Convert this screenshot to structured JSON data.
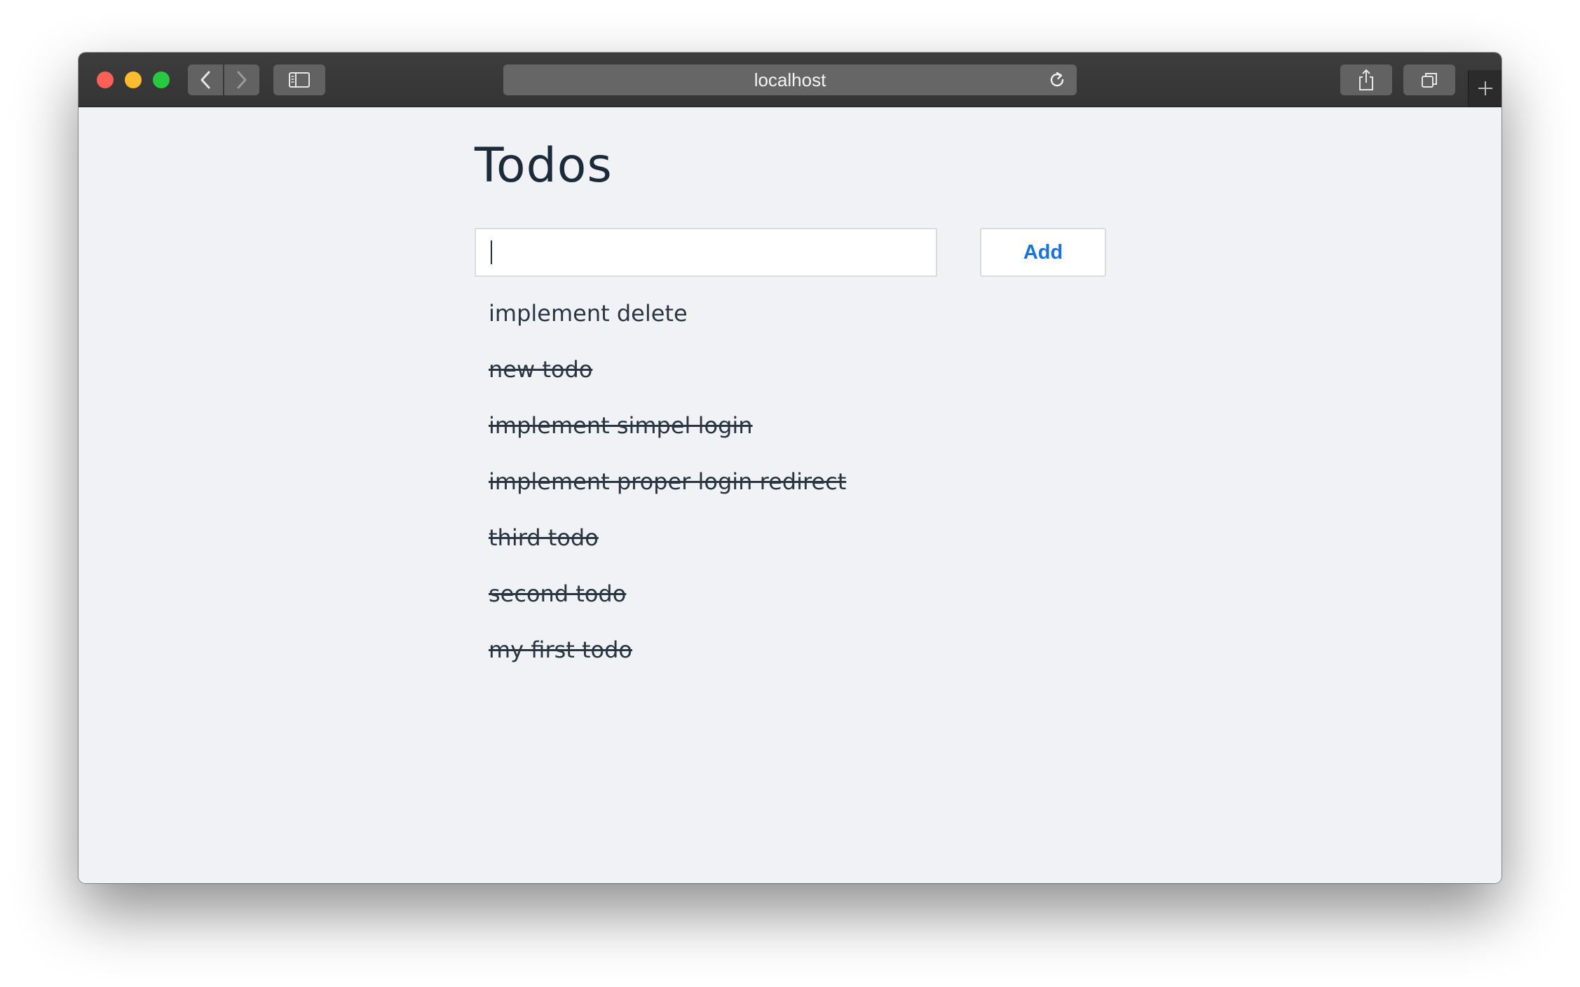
{
  "browser": {
    "address": "localhost",
    "icons": {
      "back": "chevron-left-icon",
      "forward": "chevron-right-icon",
      "sidebar": "sidebar-icon",
      "reload": "reload-icon",
      "share": "share-icon",
      "tabs": "tabs-overview-icon",
      "new_tab": "plus-icon"
    }
  },
  "page": {
    "title": "Todos",
    "input": {
      "value": "",
      "placeholder": ""
    },
    "add_label": "Add",
    "todos": [
      {
        "text": "implement delete",
        "done": false
      },
      {
        "text": "new todo",
        "done": true
      },
      {
        "text": "implement simpel login",
        "done": true
      },
      {
        "text": "implement proper login redirect",
        "done": true
      },
      {
        "text": "third todo",
        "done": true
      },
      {
        "text": "second todo",
        "done": true
      },
      {
        "text": "my first todo",
        "done": true
      }
    ]
  },
  "colors": {
    "accent": "#1a73d9",
    "text": "#1c2b3a",
    "background": "#f1f2f6"
  }
}
